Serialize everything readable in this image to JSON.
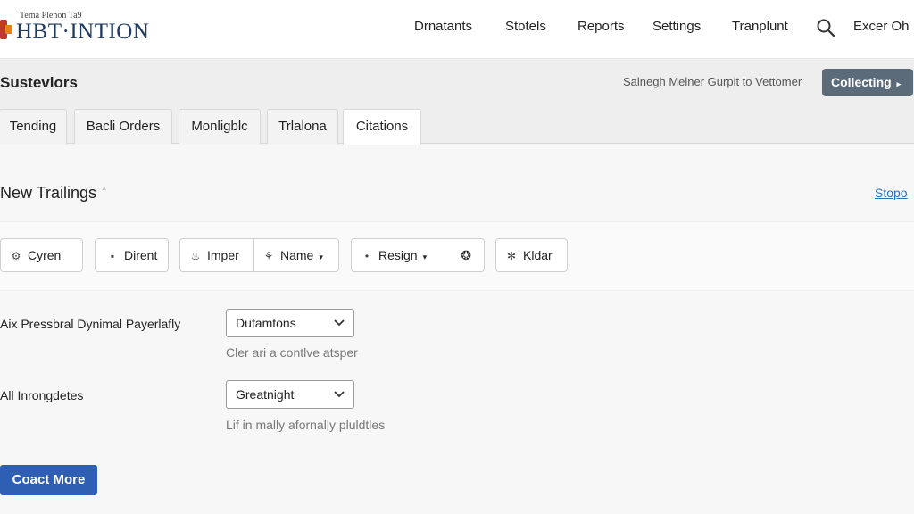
{
  "brand": {
    "small": "Tema Plenon Ta9",
    "name": "HBT·INTION"
  },
  "nav": [
    "Drnatants",
    "Stotels",
    "Reports",
    "Settings",
    "Tranplunt",
    "Excer Oh"
  ],
  "titlebar": {
    "title": "Sustevlors",
    "suggestion": "Salnegh Melner Gurpit to Vettomer",
    "collect_label": "Collecting"
  },
  "tabs": [
    {
      "label": "Tending"
    },
    {
      "label": "Bacli Orders"
    },
    {
      "label": "Monligblc"
    },
    {
      "label": "Trlalona"
    },
    {
      "label": "Citations",
      "active": true
    }
  ],
  "section": {
    "title": "New Trailings",
    "title_mark": "×",
    "stop_link": "Stopo"
  },
  "filters": [
    {
      "label": "Cyren",
      "icon": "gear-icon"
    },
    {
      "label": "Dirent",
      "icon": "square-icon"
    },
    {
      "label": "Imper",
      "icon": "flame-icon",
      "split_label": "Name",
      "split_icon": "tag-icon"
    },
    {
      "label": "Resign",
      "icon": "dot-icon",
      "extra_icon": "chip-icon"
    },
    {
      "label": "Kldar",
      "icon": "asterisk-icon"
    }
  ],
  "form": {
    "field1": {
      "label": "Aix Pressbral Dynimal Payerlafly",
      "value": "Dufamtons",
      "help": "Cler ari a contlve atsper"
    },
    "field2": {
      "label": "All Inrongdetes",
      "value": "Greatnight",
      "help": "Lif in mally afornally pluldtles"
    }
  },
  "primary_button": "Coact More",
  "colors": {
    "accent": "#2f5fb3",
    "secondary_button": "#5c6b7a",
    "link": "#2a6fb5"
  }
}
